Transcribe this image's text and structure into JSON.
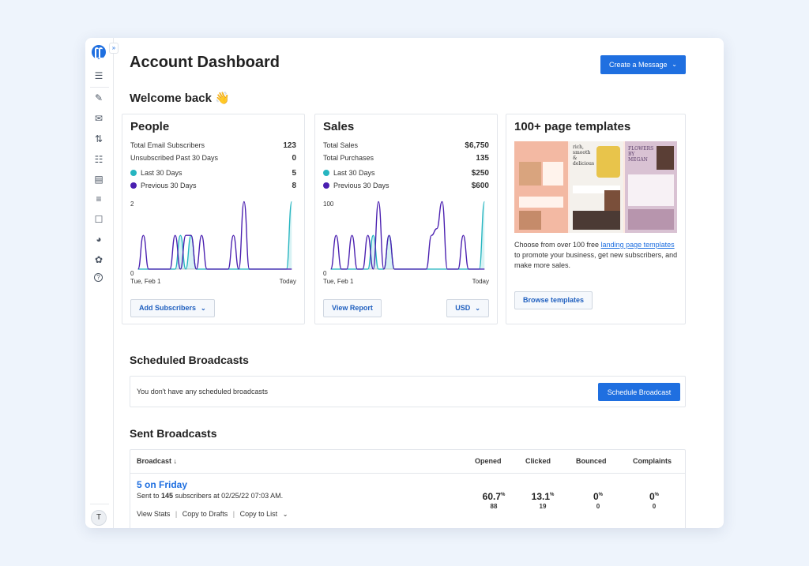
{
  "header": {
    "title": "Account Dashboard",
    "create_button": "Create a Message",
    "welcome": "Welcome back 👋"
  },
  "sidebar": {
    "expand_icon": "»",
    "items": [
      {
        "icon": "list-icon",
        "glyph": "☰"
      },
      {
        "icon": "signup-form-icon",
        "glyph": "✎"
      },
      {
        "icon": "envelope-icon",
        "glyph": "✉"
      },
      {
        "icon": "automation-icon",
        "glyph": "⇅"
      },
      {
        "icon": "contacts-icon",
        "glyph": "☷"
      },
      {
        "icon": "landing-page-icon",
        "glyph": "▤"
      },
      {
        "icon": "settings-sliders-icon",
        "glyph": "≡"
      },
      {
        "icon": "chat-icon",
        "glyph": "☐"
      },
      {
        "icon": "reports-pie-icon",
        "glyph": "◕"
      },
      {
        "icon": "integrations-icon",
        "glyph": "✿"
      },
      {
        "icon": "help-icon",
        "glyph": "?"
      }
    ],
    "avatar": "T"
  },
  "people": {
    "title": "People",
    "total_label": "Total Email Subscribers",
    "total_value": "123",
    "unsub_label": "Unsubscribed Past 30 Days",
    "unsub_value": "0",
    "last_label": "Last 30 Days",
    "last_value": "5",
    "prev_label": "Previous 30 Days",
    "prev_value": "8",
    "y_top": "2",
    "y_bottom": "0",
    "x_start": "Tue, Feb 1",
    "x_end": "Today",
    "button": "Add Subscribers"
  },
  "sales": {
    "title": "Sales",
    "total_label": "Total Sales",
    "total_value": "$6,750",
    "purch_label": "Total Purchases",
    "purch_value": "135",
    "last_label": "Last 30 Days",
    "last_value": "$250",
    "prev_label": "Previous 30 Days",
    "prev_value": "$600",
    "y_top": "100",
    "y_bottom": "0",
    "x_start": "Tue, Feb 1",
    "x_end": "Today",
    "button": "View Report",
    "currency": "USD"
  },
  "templates": {
    "title": "100+ page templates",
    "desc_before": "Choose from over 100 free ",
    "desc_link": "landing page templates",
    "desc_after": " to promote your business, get new subscribers, and make more sales.",
    "button": "Browse templates",
    "preview_text_1": "rich, smooth & delicious",
    "preview_text_2": "FLOWERS BY MEGAN"
  },
  "scheduled": {
    "title": "Scheduled Broadcasts",
    "empty_text": "You don't have any scheduled broadcasts",
    "button": "Schedule Broadcast"
  },
  "sent": {
    "title": "Sent Broadcasts",
    "headers": {
      "broadcast": "Broadcast ↓",
      "opened": "Opened",
      "clicked": "Clicked",
      "bounced": "Bounced",
      "complaints": "Complaints"
    },
    "rows": [
      {
        "name": "5 on Friday",
        "sent_prefix": "Sent to ",
        "sent_count": "145",
        "sent_suffix": " subscribers at 02/25/22 07:03 AM.",
        "opened_pct": "60.7",
        "opened_cnt": "88",
        "clicked_pct": "13.1",
        "clicked_cnt": "19",
        "bounced_pct": "0",
        "bounced_cnt": "0",
        "complaints_pct": "0",
        "complaints_cnt": "0",
        "actions": {
          "view_stats": "View Stats",
          "copy_drafts": "Copy to Drafts",
          "copy_list": "Copy to List"
        }
      }
    ]
  },
  "colors": {
    "accent": "#1f6fe0",
    "last_30": "#26b5c0",
    "previous_30": "#4a1fb0"
  },
  "chart_data": [
    {
      "type": "line",
      "title": "People",
      "x": [
        "Tue, Feb 1",
        "Today"
      ],
      "ylim": [
        0,
        2
      ],
      "series": [
        {
          "name": "Last 30 Days",
          "values": [
            0,
            0,
            0,
            0,
            0,
            0,
            0,
            0,
            1,
            0,
            1,
            0,
            0,
            0,
            0,
            0,
            0,
            0,
            0,
            0,
            0,
            0,
            0,
            0,
            0,
            0,
            0,
            0,
            0,
            2
          ]
        },
        {
          "name": "Previous 30 Days",
          "values": [
            0,
            1,
            0,
            0,
            0,
            0,
            0,
            1,
            0,
            1,
            1,
            0,
            1,
            0,
            0,
            0,
            0,
            0,
            1,
            0,
            2,
            0,
            0,
            0,
            0,
            0,
            0,
            0,
            0,
            0
          ]
        }
      ]
    },
    {
      "type": "line",
      "title": "Sales",
      "x": [
        "Tue, Feb 1",
        "Today"
      ],
      "ylim": [
        0,
        100
      ],
      "series": [
        {
          "name": "Last 30 Days",
          "values": [
            0,
            0,
            0,
            0,
            0,
            0,
            0,
            0,
            50,
            0,
            0,
            50,
            0,
            0,
            0,
            0,
            0,
            0,
            0,
            0,
            0,
            0,
            0,
            0,
            0,
            0,
            0,
            0,
            0,
            100
          ]
        },
        {
          "name": "Previous 30 Days",
          "values": [
            0,
            50,
            0,
            0,
            50,
            0,
            0,
            50,
            0,
            100,
            0,
            50,
            0,
            0,
            0,
            0,
            0,
            0,
            0,
            50,
            60,
            100,
            0,
            0,
            0,
            50,
            0,
            0,
            0,
            0
          ]
        }
      ]
    }
  ]
}
